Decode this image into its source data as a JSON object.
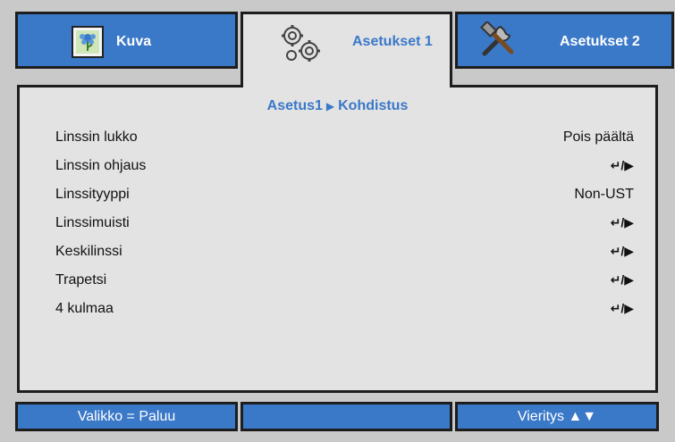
{
  "tabs": [
    {
      "label": "Kuva",
      "icon": "picture-icon"
    },
    {
      "label": "Asetukset 1",
      "icon": "gears-icon"
    },
    {
      "label": "Asetukset 2",
      "icon": "tools-icon"
    }
  ],
  "active_tab": 1,
  "breadcrumb": {
    "parent": "Asetus1",
    "separator": "▶",
    "child": "Kohdistus"
  },
  "menu_items": [
    {
      "label": "Linssin lukko",
      "value": "Pois päältä"
    },
    {
      "label": "Linssin ohjaus",
      "value": "↵/▶"
    },
    {
      "label": "Linssityyppi",
      "value": "Non-UST"
    },
    {
      "label": "Linssimuisti",
      "value": "↵/▶"
    },
    {
      "label": "Keskilinssi",
      "value": "↵/▶"
    },
    {
      "label": "Trapetsi",
      "value": "↵/▶"
    },
    {
      "label": "4 kulmaa",
      "value": "↵/▶"
    }
  ],
  "footer": {
    "left": "Valikko = Paluu",
    "middle": "",
    "right": "Vieritys ▲▼"
  },
  "colors": {
    "accent": "#3a78c8",
    "panel": "#e3e3e3",
    "frame": "#c9c9c9",
    "border": "#1d1d1d"
  }
}
